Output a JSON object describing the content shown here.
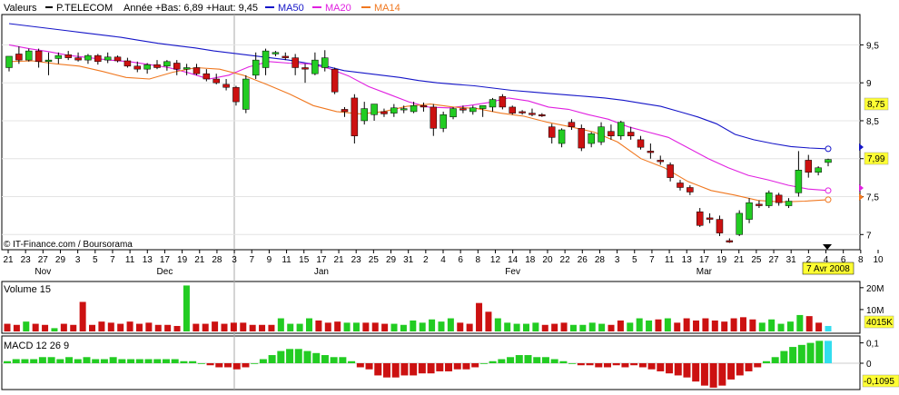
{
  "header": {
    "valeurs_label": "Valeurs",
    "ticker": "P.TELECOM",
    "range_text": "Année +Bas: 6,89 +Haut: 9,45",
    "legend": [
      {
        "label": "MA50",
        "color": "#1515c8"
      },
      {
        "label": "MA20",
        "color": "#e020e0"
      },
      {
        "label": "MA14",
        "color": "#f07820"
      }
    ]
  },
  "watermark": "© IT-Finance.com / Boursorama",
  "colors": {
    "up": "#22cc22",
    "down": "#cc1111",
    "last_volume": "#33ddee",
    "highlight": "#ffff33"
  },
  "price_axis": {
    "ticks": [
      {
        "label": "9,5",
        "value": 9.5
      },
      {
        "label": "9",
        "value": 9.0
      },
      {
        "label": "8,5",
        "value": 8.5
      },
      {
        "label": "8",
        "value": 8.0
      },
      {
        "label": "7,5",
        "value": 7.5
      },
      {
        "label": "7",
        "value": 7.0
      }
    ],
    "highlight_labels": [
      {
        "label": "8,75",
        "value": 8.75
      },
      {
        "label": "7,99",
        "value": 7.99
      }
    ]
  },
  "date_axis": {
    "day_labels": [
      "21",
      "23",
      "27",
      "29",
      "3",
      "5",
      "7",
      "11",
      "13",
      "17",
      "19",
      "21",
      "28",
      "3",
      "7",
      "9",
      "11",
      "15",
      "17",
      "21",
      "23",
      "25",
      "29",
      "31",
      "2",
      "4",
      "6",
      "8",
      "12",
      "14",
      "18",
      "20",
      "22",
      "26",
      "28",
      "3",
      "5",
      "7",
      "11",
      "13",
      "17",
      "19",
      "21",
      "25",
      "27",
      "31",
      "2",
      "4",
      "6",
      "8",
      "10"
    ],
    "month_labels": [
      {
        "label": "Nov",
        "day_index": 2
      },
      {
        "label": "Dec",
        "day_index": 9
      },
      {
        "label": "Jan",
        "day_index": 18
      },
      {
        "label": "Fev",
        "day_index": 29
      },
      {
        "label": "Mar",
        "day_index": 40
      }
    ],
    "current_date": "7 Avr 2008"
  },
  "volume_panel": {
    "title": "Volume 15",
    "ticks": [
      {
        "label": "20M",
        "value": 20
      },
      {
        "label": "10M",
        "value": 10
      }
    ],
    "last_label": "4015K"
  },
  "macd_panel": {
    "title": "MACD 12 26 9",
    "ticks": [
      {
        "label": "0,1",
        "value": 0.1
      },
      {
        "label": "0",
        "value": 0
      }
    ],
    "last_label": "-0,1095"
  },
  "chart_data": {
    "type": "candlestick",
    "series_names": [
      "P.TELECOM",
      "MA50",
      "MA20",
      "MA14",
      "Volume",
      "MACD 12 26 9"
    ],
    "candles": [
      {
        "o": 9.2,
        "h": 9.32,
        "l": 9.15,
        "c": 9.35
      },
      {
        "o": 9.38,
        "h": 9.48,
        "l": 9.25,
        "c": 9.3
      },
      {
        "o": 9.3,
        "h": 9.45,
        "l": 9.28,
        "c": 9.42
      },
      {
        "o": 9.42,
        "h": 9.45,
        "l": 9.2,
        "c": 9.28
      },
      {
        "o": 9.28,
        "h": 9.4,
        "l": 9.1,
        "c": 9.3
      },
      {
        "o": 9.32,
        "h": 9.4,
        "l": 9.25,
        "c": 9.36
      },
      {
        "o": 9.37,
        "h": 9.42,
        "l": 9.3,
        "c": 9.33
      },
      {
        "o": 9.33,
        "h": 9.4,
        "l": 9.28,
        "c": 9.3
      },
      {
        "o": 9.3,
        "h": 9.38,
        "l": 9.25,
        "c": 9.36
      },
      {
        "o": 9.36,
        "h": 9.38,
        "l": 9.24,
        "c": 9.28
      },
      {
        "o": 9.3,
        "h": 9.4,
        "l": 9.26,
        "c": 9.34
      },
      {
        "o": 9.34,
        "h": 9.36,
        "l": 9.27,
        "c": 9.29
      },
      {
        "o": 9.29,
        "h": 9.33,
        "l": 9.2,
        "c": 9.22
      },
      {
        "o": 9.22,
        "h": 9.28,
        "l": 9.14,
        "c": 9.18
      },
      {
        "o": 9.18,
        "h": 9.26,
        "l": 9.12,
        "c": 9.24
      },
      {
        "o": 9.24,
        "h": 9.3,
        "l": 9.18,
        "c": 9.2
      },
      {
        "o": 9.22,
        "h": 9.3,
        "l": 9.16,
        "c": 9.28
      },
      {
        "o": 9.26,
        "h": 9.3,
        "l": 9.1,
        "c": 9.18
      },
      {
        "o": 9.18,
        "h": 9.25,
        "l": 9.1,
        "c": 9.2
      },
      {
        "o": 9.2,
        "h": 9.25,
        "l": 9.1,
        "c": 9.12
      },
      {
        "o": 9.12,
        "h": 9.18,
        "l": 9.02,
        "c": 9.05
      },
      {
        "o": 9.05,
        "h": 9.12,
        "l": 8.98,
        "c": 9.0
      },
      {
        "o": 8.98,
        "h": 9.05,
        "l": 8.9,
        "c": 8.94
      },
      {
        "o": 8.94,
        "h": 8.96,
        "l": 8.7,
        "c": 8.75
      },
      {
        "o": 8.65,
        "h": 9.1,
        "l": 8.6,
        "c": 9.05
      },
      {
        "o": 9.1,
        "h": 9.4,
        "l": 9.05,
        "c": 9.3
      },
      {
        "o": 9.2,
        "h": 9.45,
        "l": 9.1,
        "c": 9.42
      },
      {
        "o": 9.38,
        "h": 9.42,
        "l": 9.35,
        "c": 9.4
      },
      {
        "o": 9.35,
        "h": 9.4,
        "l": 9.3,
        "c": 9.33
      },
      {
        "o": 9.33,
        "h": 9.38,
        "l": 9.1,
        "c": 9.2
      },
      {
        "o": 9.2,
        "h": 9.25,
        "l": 9.0,
        "c": 9.18
      },
      {
        "o": 9.12,
        "h": 9.4,
        "l": 9.1,
        "c": 9.3
      },
      {
        "o": 9.2,
        "h": 9.43,
        "l": 9.15,
        "c": 9.33
      },
      {
        "o": 9.18,
        "h": 9.2,
        "l": 8.85,
        "c": 8.88
      },
      {
        "o": 8.65,
        "h": 8.68,
        "l": 8.55,
        "c": 8.62
      },
      {
        "o": 8.8,
        "h": 8.85,
        "l": 8.2,
        "c": 8.3
      },
      {
        "o": 8.5,
        "h": 8.75,
        "l": 8.45,
        "c": 8.66
      },
      {
        "o": 8.58,
        "h": 8.7,
        "l": 8.5,
        "c": 8.72
      },
      {
        "o": 8.62,
        "h": 8.66,
        "l": 8.55,
        "c": 8.59
      },
      {
        "o": 8.6,
        "h": 8.72,
        "l": 8.55,
        "c": 8.67
      },
      {
        "o": 8.65,
        "h": 8.7,
        "l": 8.6,
        "c": 8.66
      },
      {
        "o": 8.62,
        "h": 8.75,
        "l": 8.6,
        "c": 8.7
      },
      {
        "o": 8.7,
        "h": 8.74,
        "l": 8.62,
        "c": 8.68
      },
      {
        "o": 8.68,
        "h": 8.72,
        "l": 8.3,
        "c": 8.4
      },
      {
        "o": 8.4,
        "h": 8.62,
        "l": 8.35,
        "c": 8.58
      },
      {
        "o": 8.55,
        "h": 8.68,
        "l": 8.52,
        "c": 8.66
      },
      {
        "o": 8.66,
        "h": 8.7,
        "l": 8.6,
        "c": 8.64
      },
      {
        "o": 8.62,
        "h": 8.7,
        "l": 8.58,
        "c": 8.67
      },
      {
        "o": 8.66,
        "h": 8.7,
        "l": 8.55,
        "c": 8.7
      },
      {
        "o": 8.68,
        "h": 8.8,
        "l": 8.62,
        "c": 8.78
      },
      {
        "o": 8.82,
        "h": 8.85,
        "l": 8.65,
        "c": 8.68
      },
      {
        "o": 8.68,
        "h": 8.7,
        "l": 8.58,
        "c": 8.6
      },
      {
        "o": 8.62,
        "h": 8.64,
        "l": 8.58,
        "c": 8.61
      },
      {
        "o": 8.6,
        "h": 8.66,
        "l": 8.56,
        "c": 8.58
      },
      {
        "o": 8.58,
        "h": 8.6,
        "l": 8.55,
        "c": 8.57
      },
      {
        "o": 8.42,
        "h": 8.46,
        "l": 8.2,
        "c": 8.28
      },
      {
        "o": 8.2,
        "h": 8.4,
        "l": 8.15,
        "c": 8.38
      },
      {
        "o": 8.48,
        "h": 8.52,
        "l": 8.38,
        "c": 8.42
      },
      {
        "o": 8.4,
        "h": 8.45,
        "l": 8.1,
        "c": 8.14
      },
      {
        "o": 8.2,
        "h": 8.35,
        "l": 8.15,
        "c": 8.33
      },
      {
        "o": 8.22,
        "h": 8.48,
        "l": 8.18,
        "c": 8.42
      },
      {
        "o": 8.36,
        "h": 8.45,
        "l": 8.25,
        "c": 8.3
      },
      {
        "o": 8.3,
        "h": 8.5,
        "l": 8.25,
        "c": 8.48
      },
      {
        "o": 8.35,
        "h": 8.42,
        "l": 8.25,
        "c": 8.3
      },
      {
        "o": 8.25,
        "h": 8.3,
        "l": 8.12,
        "c": 8.15
      },
      {
        "o": 8.1,
        "h": 8.2,
        "l": 8.0,
        "c": 8.08
      },
      {
        "o": 7.98,
        "h": 8.04,
        "l": 7.92,
        "c": 7.96
      },
      {
        "o": 7.92,
        "h": 7.95,
        "l": 7.7,
        "c": 7.75
      },
      {
        "o": 7.68,
        "h": 7.72,
        "l": 7.58,
        "c": 7.62
      },
      {
        "o": 7.62,
        "h": 7.65,
        "l": 7.52,
        "c": 7.56
      },
      {
        "o": 7.3,
        "h": 7.35,
        "l": 7.1,
        "c": 7.12
      },
      {
        "o": 7.22,
        "h": 7.28,
        "l": 7.15,
        "c": 7.2
      },
      {
        "o": 7.2,
        "h": 7.25,
        "l": 6.98,
        "c": 7.02
      },
      {
        "o": 6.92,
        "h": 6.95,
        "l": 6.89,
        "c": 6.9
      },
      {
        "o": 7.0,
        "h": 7.32,
        "l": 6.98,
        "c": 7.28
      },
      {
        "o": 7.2,
        "h": 7.48,
        "l": 7.15,
        "c": 7.42
      },
      {
        "o": 7.4,
        "h": 7.45,
        "l": 7.35,
        "c": 7.38
      },
      {
        "o": 7.38,
        "h": 7.58,
        "l": 7.35,
        "c": 7.55
      },
      {
        "o": 7.52,
        "h": 7.55,
        "l": 7.38,
        "c": 7.42
      },
      {
        "o": 7.38,
        "h": 7.48,
        "l": 7.35,
        "c": 7.44
      },
      {
        "o": 7.55,
        "h": 8.1,
        "l": 7.5,
        "c": 7.85
      },
      {
        "o": 7.98,
        "h": 8.05,
        "l": 7.75,
        "c": 7.82
      },
      {
        "o": 7.82,
        "h": 7.9,
        "l": 7.78,
        "c": 7.88
      },
      {
        "o": 7.95,
        "h": 8.0,
        "l": 7.9,
        "c": 7.99
      }
    ],
    "ma50": [
      9.78,
      9.75,
      9.72,
      9.69,
      9.66,
      9.63,
      9.6,
      9.56,
      9.52,
      9.49,
      9.46,
      9.42,
      9.39,
      9.36,
      9.33,
      9.3,
      9.26,
      9.22,
      9.16,
      9.13,
      9.1,
      9.07,
      9.03,
      9.0,
      8.98,
      8.96,
      8.93,
      8.9,
      8.88,
      8.86,
      8.84,
      8.82,
      8.8,
      8.77,
      8.73,
      8.69,
      8.62,
      8.55,
      8.46,
      8.32,
      8.25,
      8.2,
      8.16,
      8.14,
      8.13
    ],
    "ma20": [
      9.5,
      9.45,
      9.41,
      9.36,
      9.33,
      9.3,
      9.28,
      9.24,
      9.2,
      9.13,
      9.05,
      9.1,
      9.21,
      9.28,
      9.26,
      9.25,
      9.19,
      9.09,
      8.95,
      8.85,
      8.75,
      8.68,
      8.67,
      8.7,
      8.74,
      8.8,
      8.76,
      8.68,
      8.65,
      8.58,
      8.52,
      8.42,
      8.35,
      8.28,
      8.14,
      8.0,
      7.88,
      7.78,
      7.72,
      7.65,
      7.6,
      7.58
    ],
    "ma14": [
      9.28,
      9.29,
      9.25,
      9.22,
      9.15,
      9.07,
      9.05,
      9.14,
      9.2,
      9.18,
      9.1,
      8.98,
      8.85,
      8.7,
      8.62,
      8.59,
      8.62,
      8.69,
      8.72,
      8.68,
      8.66,
      8.6,
      8.56,
      8.48,
      8.42,
      8.35,
      8.22,
      8.0,
      7.88,
      7.7,
      7.58,
      7.52,
      7.45,
      7.43,
      7.44,
      7.46
    ],
    "volume_millions": [
      3.5,
      3.0,
      4.5,
      3.5,
      3.0,
      1.5,
      3.5,
      3.0,
      13.5,
      3.0,
      4.5,
      4.0,
      3.5,
      4.5,
      3.5,
      4.0,
      3.0,
      3.0,
      2.5,
      21.0,
      3.5,
      3.5,
      4.5,
      3.5,
      4.0,
      4.0,
      3.0,
      3.0,
      3.0,
      6.0,
      3.5,
      3.5,
      6.0,
      5.0,
      4.0,
      4.5,
      4.0,
      4.0,
      4.0,
      4.0,
      3.5,
      3.5,
      3.0,
      5.0,
      4.0,
      5.5,
      4.5,
      6.0,
      4.0,
      3.5,
      13.0,
      9.0,
      6.0,
      4.0,
      3.5,
      3.5,
      4.0,
      3.0,
      3.5,
      4.0,
      3.0,
      3.0,
      4.0,
      3.5,
      3.0,
      5.0,
      4.0,
      6.0,
      5.0,
      5.5,
      6.0,
      4.0,
      6.0,
      5.0,
      6.0,
      5.0,
      4.5,
      6.0,
      6.5,
      5.5,
      4.0,
      5.5,
      3.5,
      4.5,
      7.5,
      7.0,
      4.0,
      2.5
    ],
    "volume_dir": [
      0,
      0,
      1,
      0,
      0,
      1,
      0,
      0,
      0,
      0,
      0,
      0,
      0,
      0,
      0,
      0,
      0,
      0,
      0,
      1,
      0,
      0,
      0,
      0,
      0,
      0,
      0,
      0,
      0,
      1,
      1,
      1,
      1,
      0,
      0,
      0,
      1,
      1,
      0,
      0,
      0,
      1,
      1,
      1,
      1,
      1,
      1,
      1,
      0,
      0,
      0,
      0,
      1,
      1,
      1,
      1,
      1,
      0,
      0,
      0,
      1,
      1,
      1,
      1,
      0,
      0,
      1,
      1,
      1,
      0,
      1,
      0,
      0,
      0,
      0,
      0,
      0,
      0,
      0,
      0,
      1,
      1,
      1,
      1,
      1,
      0,
      0,
      0
    ],
    "macd": [
      0.01,
      0.02,
      0.02,
      0.02,
      0.03,
      0.03,
      0.02,
      0.03,
      0.02,
      0.03,
      0.02,
      0.02,
      0.03,
      0.02,
      0.02,
      0.02,
      0.02,
      0.02,
      0.02,
      0.02,
      0.01,
      0.01,
      0.0,
      -0.01,
      -0.02,
      -0.02,
      -0.03,
      -0.02,
      0.0,
      0.02,
      0.04,
      0.06,
      0.07,
      0.07,
      0.06,
      0.05,
      0.04,
      0.03,
      0.03,
      0.01,
      -0.02,
      -0.03,
      -0.06,
      -0.07,
      -0.07,
      -0.06,
      -0.06,
      -0.05,
      -0.05,
      -0.04,
      -0.04,
      -0.03,
      -0.03,
      -0.02,
      0.0,
      0.01,
      0.02,
      0.03,
      0.04,
      0.04,
      0.03,
      0.03,
      0.02,
      0.01,
      0.0,
      -0.01,
      -0.01,
      -0.02,
      -0.02,
      -0.01,
      -0.02,
      -0.01,
      -0.02,
      -0.03,
      -0.04,
      -0.05,
      -0.06,
      -0.07,
      -0.09,
      -0.11,
      -0.12,
      -0.11,
      -0.08,
      -0.06,
      -0.04,
      -0.02,
      0.01,
      0.03,
      0.06,
      0.08,
      0.09,
      0.1,
      0.11,
      0.11
    ],
    "macd_dir": [
      1,
      1,
      1,
      1,
      1,
      1,
      1,
      1,
      1,
      1,
      1,
      1,
      1,
      1,
      1,
      1,
      1,
      1,
      1,
      1,
      1,
      1,
      1,
      0,
      0,
      0,
      0,
      0,
      1,
      1,
      1,
      1,
      1,
      1,
      1,
      1,
      1,
      1,
      1,
      1,
      0,
      0,
      0,
      0,
      0,
      0,
      0,
      0,
      0,
      0,
      0,
      0,
      0,
      0,
      1,
      1,
      1,
      1,
      1,
      1,
      1,
      1,
      1,
      1,
      1,
      0,
      0,
      0,
      0,
      0,
      0,
      0,
      0,
      0,
      0,
      0,
      0,
      0,
      0,
      0,
      0,
      0,
      0,
      0,
      0,
      0,
      1,
      1,
      1,
      1,
      1,
      1,
      1,
      2
    ]
  }
}
